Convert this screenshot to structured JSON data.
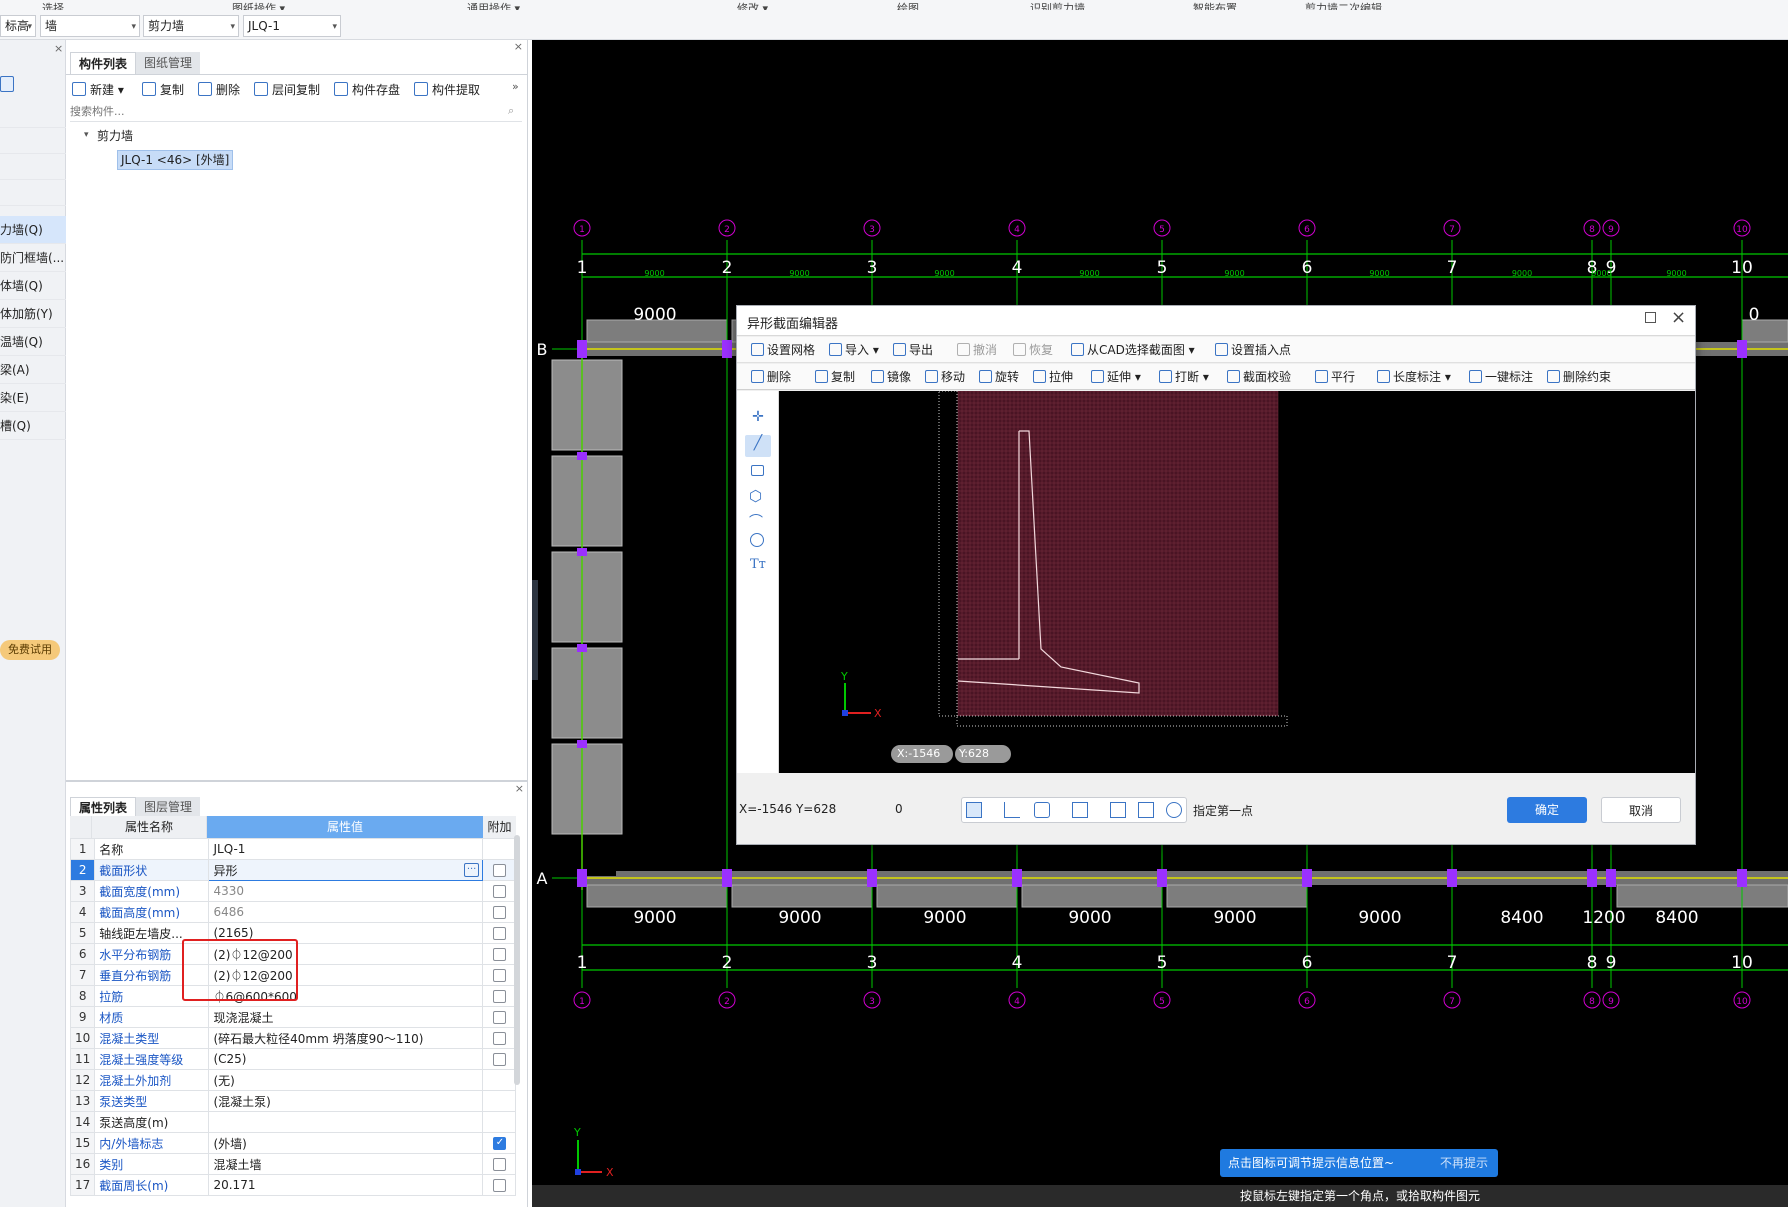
{
  "ribbon": {
    "groups": [
      "选择",
      "图纸操作 ▾",
      "通用操作 ▾",
      "修改 ▾",
      "绘图",
      "识别剪力墙",
      "智能布置",
      "剪力墙二次编辑"
    ]
  },
  "selectors": [
    {
      "value": "标高"
    },
    {
      "value": "墙"
    },
    {
      "value": "剪力墙"
    },
    {
      "value": "JLQ-1"
    }
  ],
  "left_strip": {
    "items": [
      "力墙(Q)",
      "防门框墙(...",
      "体墙(Q)",
      "体加筋(Y)",
      "温墙(Q)",
      "梁(A)",
      "染(E)",
      "槽(Q)"
    ],
    "trial_badge": "免费试用"
  },
  "component_panel": {
    "tabs": [
      "构件列表",
      "图纸管理"
    ],
    "toolbar": [
      "新建 ▾",
      "复制",
      "删除",
      "层间复制",
      "构件存盘",
      "构件提取"
    ],
    "search_placeholder": "搜索构件...",
    "tree_root": "剪力墙",
    "tree_item": "JLQ-1 <46> [外墙]"
  },
  "property_panel": {
    "tabs": [
      "属性列表",
      "图层管理"
    ],
    "headers": [
      "属性名称",
      "属性值",
      "附加"
    ],
    "rows": [
      {
        "no": "1",
        "name": "名称",
        "value": "JLQ-1",
        "checkbox": false,
        "has_cb": false
      },
      {
        "no": "2",
        "name": "截面形状",
        "value": "异形",
        "checkbox": false,
        "has_cb": true
      },
      {
        "no": "3",
        "name": "截面宽度(mm)",
        "value": "4330",
        "checkbox": false,
        "has_cb": true
      },
      {
        "no": "4",
        "name": "截面高度(mm)",
        "value": "6486",
        "checkbox": false,
        "has_cb": true
      },
      {
        "no": "5",
        "name": "轴线距左墙皮...",
        "value": "(2165)",
        "checkbox": false,
        "has_cb": true
      },
      {
        "no": "6",
        "name": "水平分布钢筋",
        "value": "(2)⏀12@200",
        "checkbox": false,
        "has_cb": true
      },
      {
        "no": "7",
        "name": "垂直分布钢筋",
        "value": "(2)⏀12@200",
        "checkbox": false,
        "has_cb": true
      },
      {
        "no": "8",
        "name": "拉筋",
        "value": "⏀6@600*600",
        "checkbox": false,
        "has_cb": true
      },
      {
        "no": "9",
        "name": "材质",
        "value": "现浇混凝土",
        "checkbox": false,
        "has_cb": true
      },
      {
        "no": "10",
        "name": "混凝土类型",
        "value": "(碎石最大粒径40mm 坍落度90～110)",
        "checkbox": false,
        "has_cb": true
      },
      {
        "no": "11",
        "name": "混凝土强度等级",
        "value": "(C25)",
        "checkbox": false,
        "has_cb": true
      },
      {
        "no": "12",
        "name": "混凝土外加剂",
        "value": "(无)",
        "checkbox": false,
        "has_cb": false
      },
      {
        "no": "13",
        "name": "泵送类型",
        "value": "(混凝土泵)",
        "checkbox": false,
        "has_cb": false
      },
      {
        "no": "14",
        "name": "泵送高度(m)",
        "value": "",
        "checkbox": false,
        "has_cb": false
      },
      {
        "no": "15",
        "name": "内/外墙标志",
        "value": "(外墙)",
        "checkbox": true,
        "has_cb": true
      },
      {
        "no": "16",
        "name": "类别",
        "value": "混凝土墙",
        "checkbox": false,
        "has_cb": true
      },
      {
        "no": "17",
        "name": "截面周长(m)",
        "value": "20.171",
        "checkbox": false,
        "has_cb": true
      }
    ]
  },
  "cad": {
    "axis_numbers": [
      "1",
      "2",
      "3",
      "4",
      "5",
      "6",
      "7",
      "8",
      "9",
      "10"
    ],
    "row_labels": [
      "B",
      "A"
    ],
    "top_dims": [
      "9000",
      "9000",
      "9000",
      "9000",
      "9000",
      "9000",
      "9000",
      "9000",
      "9000"
    ],
    "top_big_dim": "9000",
    "top_right_dim": "0",
    "bottom_dims": [
      "9000",
      "9000",
      "9000",
      "9000",
      "9000",
      "9000",
      "8400",
      "1200",
      "8400"
    ],
    "notification": "点击图标可调节提示信息位置~",
    "dismiss": "不再提示",
    "bottom_hint": "按鼠标左键指定第一个角点，或拾取构件图元",
    "axis_x": "X",
    "axis_y": "Y"
  },
  "dialog": {
    "title": "异形截面编辑器",
    "toolbar1": [
      "设置网格",
      "导入 ▾",
      "导出",
      "撤消",
      "恢复",
      "从CAD选择截面图 ▾",
      "设置插入点"
    ],
    "toolbar2": [
      "删除",
      "复制",
      "镜像",
      "移动",
      "旋转",
      "拉伸",
      "延伸 ▾",
      "打断 ▾",
      "截面校验",
      "平行",
      "长度标注 ▾",
      "一键标注",
      "删除约束"
    ],
    "coord_x": "X:-1546",
    "coord_y": "Y:628",
    "status_coords": "X=-1546 Y=628",
    "status_zero": "0",
    "status_prompt": "指定第一点",
    "ok": "确定",
    "cancel": "取消",
    "axis_x": "X",
    "axis_y": "Y"
  },
  "colors": {
    "accent": "#2d7be0",
    "grid_line": "#00c800",
    "axis_circle": "#d000d0",
    "wall_gray": "#8c8c8c",
    "joint": "#9b30ff",
    "section_bg": "#4a1424",
    "highlight_box": "#e02020"
  }
}
